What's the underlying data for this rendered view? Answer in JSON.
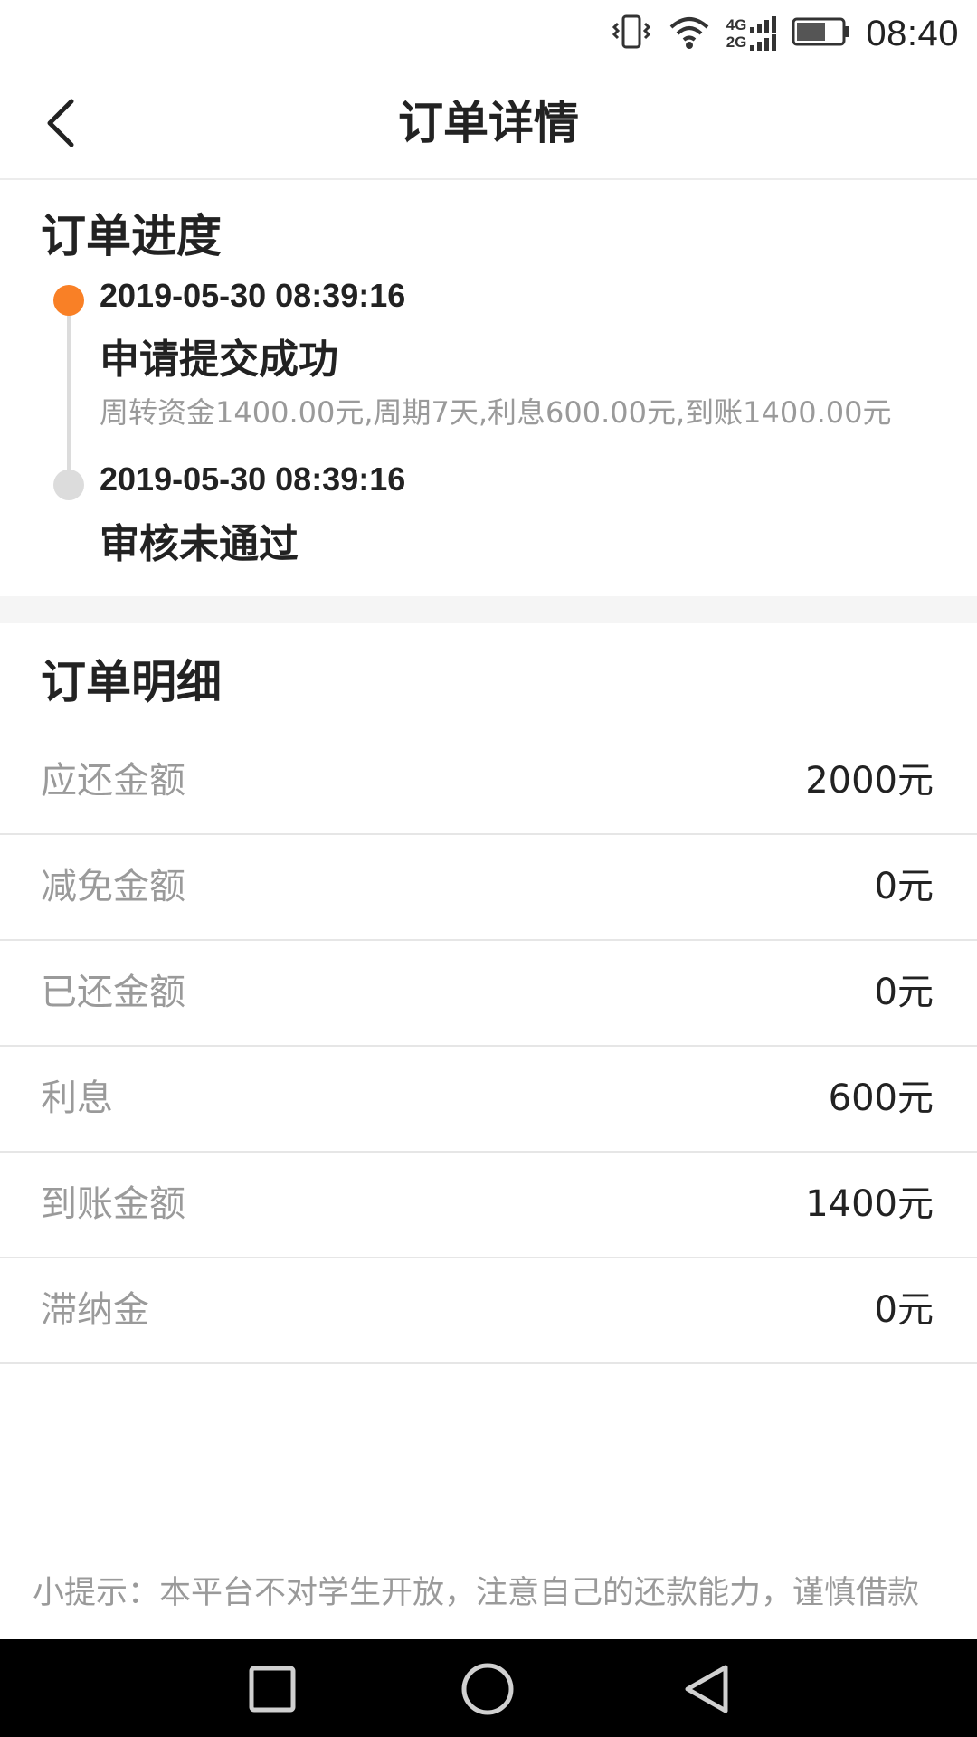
{
  "status_bar": {
    "time": "08:40",
    "network_top": "4G",
    "network_bottom": "2G",
    "icons": [
      "vibrate-icon",
      "wifi-icon",
      "signal-icon",
      "battery-icon"
    ],
    "battery_level": 0.65
  },
  "header": {
    "title": "订单详情",
    "back_icon": "chevron-left-icon"
  },
  "progress": {
    "title": "订单进度",
    "active_color": "#f98026",
    "inactive_color": "#dcdcdc",
    "events": [
      {
        "time": "2019-05-30 08:39:16",
        "title": "申请提交成功",
        "desc": "周转资金1400.00元,周期7天,利息600.00元,到账1400.00元"
      },
      {
        "time": "2019-05-30 08:39:16",
        "title": "审核未通过",
        "desc": ""
      }
    ]
  },
  "detail": {
    "title": "订单明细",
    "rows": [
      {
        "label": "应还金额",
        "value": "2000元"
      },
      {
        "label": "减免金额",
        "value": "0元"
      },
      {
        "label": "已还金额",
        "value": "0元"
      },
      {
        "label": "利息",
        "value": "600元"
      },
      {
        "label": "到账金额",
        "value": "1400元"
      },
      {
        "label": "滞纳金",
        "value": "0元"
      }
    ]
  },
  "tip": "小提示：本平台不对学生开放，注意自己的还款能力，谨慎借款",
  "nav_bar": {
    "icons": [
      "recents-square-icon",
      "home-circle-icon",
      "back-triangle-icon"
    ]
  }
}
